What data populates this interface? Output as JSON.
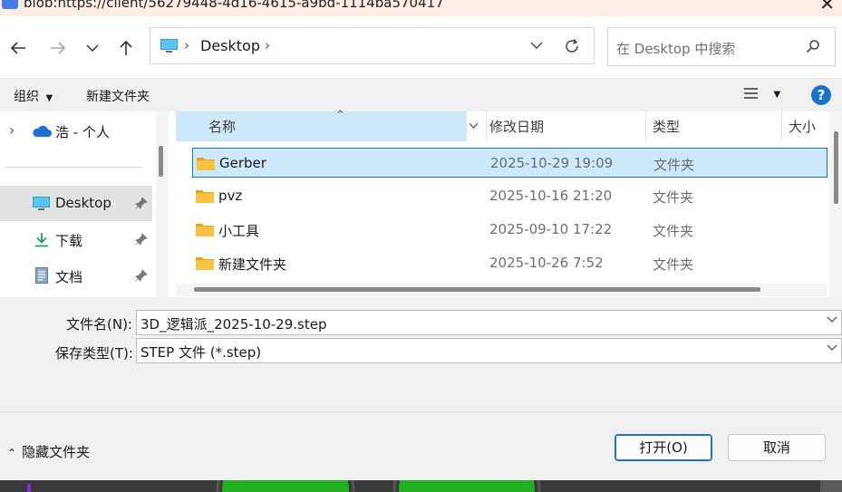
{
  "window": {
    "title": "blob:https://client/56279448-4d16-4615-a9bd-1114ba570417"
  },
  "nav": {
    "address_path": "Desktop",
    "search_placeholder": "在 Desktop 中搜索"
  },
  "toolbar": {
    "organize_label": "组织",
    "new_folder_label": "新建文件夹",
    "help_label": "?"
  },
  "sidebar": {
    "items": [
      {
        "label": "浩 - 个人",
        "icon": "onedrive-cloud-icon"
      },
      {
        "label": "Desktop",
        "icon": "desktop-icon",
        "pinned": true,
        "selected": true
      },
      {
        "label": "下载",
        "icon": "download-arrow-icon",
        "pinned": true
      },
      {
        "label": "文档",
        "icon": "document-icon",
        "pinned": true
      }
    ]
  },
  "file_list": {
    "columns": [
      "名称",
      "修改日期",
      "类型",
      "大小"
    ],
    "rows": [
      {
        "name": "Gerber",
        "date": "2025-10-29 19:09",
        "type": "文件夹",
        "selected": true
      },
      {
        "name": "pvz",
        "date": "2025-10-16 21:20",
        "type": "文件夹"
      },
      {
        "name": "小工具",
        "date": "2025-09-10 17:22",
        "type": "文件夹"
      },
      {
        "name": "新建文件夹",
        "date": "2025-10-26 7:52",
        "type": "文件夹"
      }
    ]
  },
  "form": {
    "filename_label": "文件名(N):",
    "filename_value": "3D_逻辑派_2025-10-29.step",
    "filetype_label": "保存类型(T):",
    "filetype_value": "STEP 文件 (*.step)"
  },
  "footer": {
    "hide_folders_label": "隐藏文件夹",
    "open_label": "打开(O)",
    "cancel_label": "取消"
  },
  "colors": {
    "accent": "#1a73c9",
    "selection": "#cde8fb",
    "folder": "#f5c242"
  }
}
